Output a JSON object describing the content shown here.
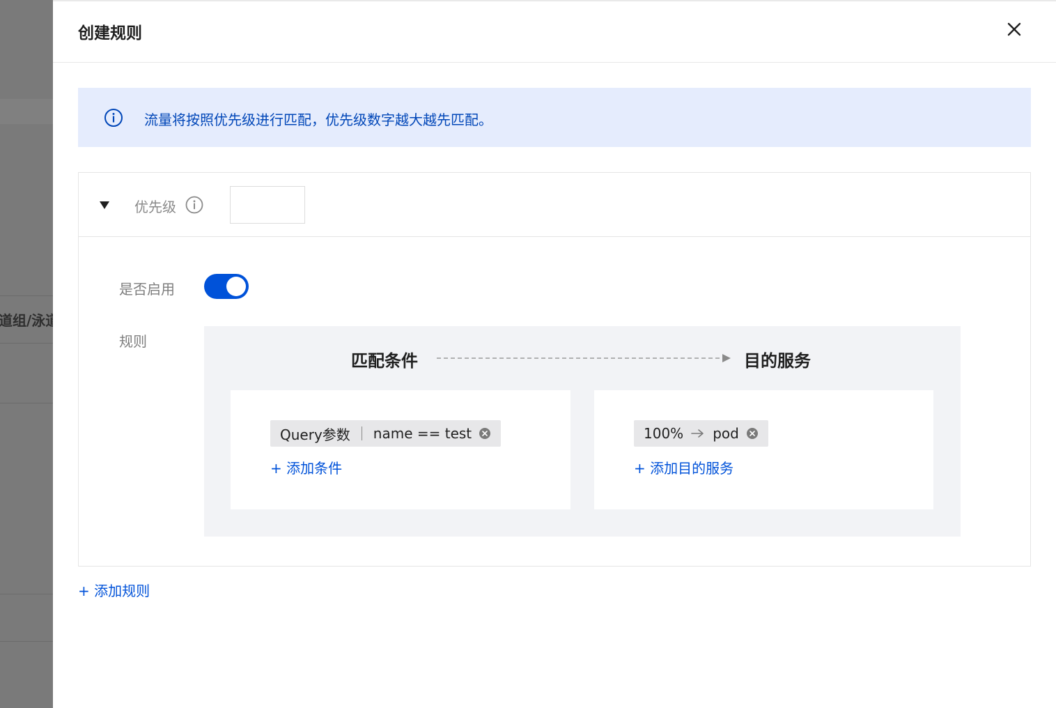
{
  "backdrop": {
    "partial_text": "道组/泳道"
  },
  "drawer": {
    "title": "创建规则",
    "close_icon": "close-icon"
  },
  "alert": {
    "icon": "info-icon",
    "text": "流量将按照优先级进行匹配，优先级数字越大越先匹配。"
  },
  "rule": {
    "collapse_icon": "caret-down-icon",
    "priority_label": "优先级",
    "priority_value": "",
    "enable_label": "是否启用",
    "enabled": true,
    "rules_label": "规则",
    "match_title": "匹配条件",
    "dest_title": "目的服务",
    "condition": {
      "type": "Query参数",
      "expression": "name == test"
    },
    "add_condition": "+ 添加条件",
    "destination": {
      "weight": "100%",
      "service": "pod"
    },
    "add_destination": "+ 添加目的服务"
  },
  "add_rule": "+ 添加规则",
  "colors": {
    "primary": "#0052d9",
    "alert_bg": "#e5ecfd",
    "alert_text": "#0046b8",
    "panel_bg": "#f2f3f6",
    "tag_bg": "#e7e7e9"
  }
}
